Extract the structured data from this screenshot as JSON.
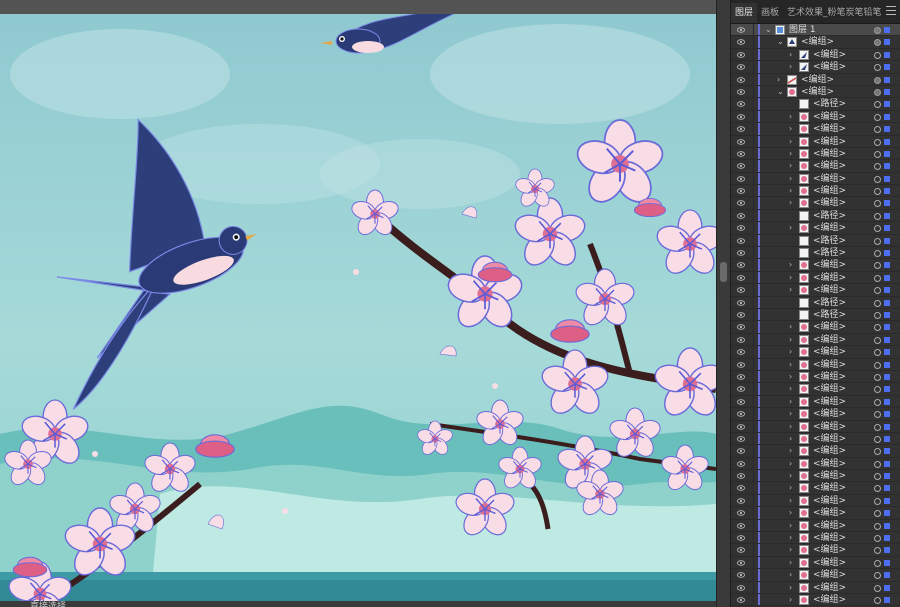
{
  "panel": {
    "tabs": [
      {
        "label": "图层",
        "active": true
      },
      {
        "label": "画板",
        "active": false
      },
      {
        "label": "艺术效果_粉笔炭笔铅笔",
        "active": false
      }
    ]
  },
  "status": {
    "text": "直接选择"
  },
  "colors": {
    "accent": "#4d6ef0",
    "layer_color": "#6b6bd4",
    "sky": "#9fd3d6",
    "swallow": "#2d3f7a",
    "blossom": "#f7d9e2",
    "branch": "#3b1d1d"
  },
  "layers": [
    {
      "depth": 0,
      "arrow": "down",
      "icon": "layer",
      "label": "图层 1",
      "selected": true,
      "target": "filled"
    },
    {
      "depth": 1,
      "arrow": "down",
      "icon": "group",
      "label": "<编组>",
      "target": "filled"
    },
    {
      "depth": 2,
      "arrow": "right",
      "icon": "swallow",
      "label": "<编组>",
      "target": "empty"
    },
    {
      "depth": 2,
      "arrow": "right",
      "icon": "swallow",
      "label": "<编组>",
      "target": "empty"
    },
    {
      "depth": 1,
      "arrow": "right",
      "icon": "branch",
      "label": "<编组>",
      "target": "filled"
    },
    {
      "depth": 1,
      "arrow": "down",
      "icon": "flower",
      "label": "<编组>",
      "target": "filled"
    },
    {
      "depth": 2,
      "arrow": "none",
      "icon": "path",
      "label": "<路径>",
      "target": "empty"
    },
    {
      "depth": 2,
      "arrow": "right",
      "icon": "flower",
      "label": "<编组>",
      "target": "empty"
    },
    {
      "depth": 2,
      "arrow": "right",
      "icon": "flower",
      "label": "<编组>",
      "target": "empty"
    },
    {
      "depth": 2,
      "arrow": "right",
      "icon": "flower",
      "label": "<编组>",
      "target": "empty"
    },
    {
      "depth": 2,
      "arrow": "right",
      "icon": "flower",
      "label": "<编组>",
      "target": "empty"
    },
    {
      "depth": 2,
      "arrow": "right",
      "icon": "flower",
      "label": "<编组>",
      "target": "empty"
    },
    {
      "depth": 2,
      "arrow": "right",
      "icon": "flower",
      "label": "<编组>",
      "target": "empty"
    },
    {
      "depth": 2,
      "arrow": "right",
      "icon": "flower",
      "label": "<编组>",
      "target": "empty"
    },
    {
      "depth": 2,
      "arrow": "right",
      "icon": "flower",
      "label": "<编组>",
      "target": "empty"
    },
    {
      "depth": 2,
      "arrow": "none",
      "icon": "path",
      "label": "<路径>",
      "target": "empty"
    },
    {
      "depth": 2,
      "arrow": "right",
      "icon": "flower",
      "label": "<编组>",
      "target": "empty"
    },
    {
      "depth": 2,
      "arrow": "none",
      "icon": "path",
      "label": "<路径>",
      "target": "empty"
    },
    {
      "depth": 2,
      "arrow": "none",
      "icon": "path",
      "label": "<路径>",
      "target": "empty"
    },
    {
      "depth": 2,
      "arrow": "right",
      "icon": "flower",
      "label": "<编组>",
      "target": "empty"
    },
    {
      "depth": 2,
      "arrow": "right",
      "icon": "flower",
      "label": "<编组>",
      "target": "empty"
    },
    {
      "depth": 2,
      "arrow": "right",
      "icon": "flower",
      "label": "<编组>",
      "target": "empty"
    },
    {
      "depth": 2,
      "arrow": "none",
      "icon": "path",
      "label": "<路径>",
      "target": "empty"
    },
    {
      "depth": 2,
      "arrow": "none",
      "icon": "path",
      "label": "<路径>",
      "target": "empty"
    },
    {
      "depth": 2,
      "arrow": "right",
      "icon": "flower",
      "label": "<编组>",
      "target": "empty"
    },
    {
      "depth": 2,
      "arrow": "right",
      "icon": "flower",
      "label": "<编组>",
      "target": "empty"
    },
    {
      "depth": 2,
      "arrow": "right",
      "icon": "flower",
      "label": "<编组>",
      "target": "empty"
    },
    {
      "depth": 2,
      "arrow": "right",
      "icon": "flower",
      "label": "<编组>",
      "target": "empty"
    },
    {
      "depth": 2,
      "arrow": "right",
      "icon": "flower",
      "label": "<编组>",
      "target": "empty"
    },
    {
      "depth": 2,
      "arrow": "right",
      "icon": "flower",
      "label": "<编组>",
      "target": "empty"
    },
    {
      "depth": 2,
      "arrow": "right",
      "icon": "flower",
      "label": "<编组>",
      "target": "empty"
    },
    {
      "depth": 2,
      "arrow": "right",
      "icon": "flower",
      "label": "<编组>",
      "target": "empty"
    },
    {
      "depth": 2,
      "arrow": "right",
      "icon": "flower",
      "label": "<编组>",
      "target": "empty"
    },
    {
      "depth": 2,
      "arrow": "right",
      "icon": "flower",
      "label": "<编组>",
      "target": "empty"
    },
    {
      "depth": 2,
      "arrow": "right",
      "icon": "flower",
      "label": "<编组>",
      "target": "empty"
    },
    {
      "depth": 2,
      "arrow": "right",
      "icon": "flower",
      "label": "<编组>",
      "target": "empty"
    },
    {
      "depth": 2,
      "arrow": "right",
      "icon": "flower",
      "label": "<编组>",
      "target": "empty"
    },
    {
      "depth": 2,
      "arrow": "right",
      "icon": "flower",
      "label": "<编组>",
      "target": "empty"
    },
    {
      "depth": 2,
      "arrow": "right",
      "icon": "flower",
      "label": "<编组>",
      "target": "empty"
    },
    {
      "depth": 2,
      "arrow": "right",
      "icon": "flower",
      "label": "<编组>",
      "target": "empty"
    },
    {
      "depth": 2,
      "arrow": "right",
      "icon": "flower",
      "label": "<编组>",
      "target": "empty"
    },
    {
      "depth": 2,
      "arrow": "right",
      "icon": "flower",
      "label": "<编组>",
      "target": "empty"
    },
    {
      "depth": 2,
      "arrow": "right",
      "icon": "flower",
      "label": "<编组>",
      "target": "empty"
    },
    {
      "depth": 2,
      "arrow": "right",
      "icon": "flower",
      "label": "<编组>",
      "target": "empty"
    },
    {
      "depth": 2,
      "arrow": "right",
      "icon": "flower",
      "label": "<编组>",
      "target": "empty"
    },
    {
      "depth": 2,
      "arrow": "right",
      "icon": "flower",
      "label": "<编组>",
      "target": "empty"
    },
    {
      "depth": 2,
      "arrow": "right",
      "icon": "flower",
      "label": "<编组>",
      "target": "empty"
    }
  ]
}
